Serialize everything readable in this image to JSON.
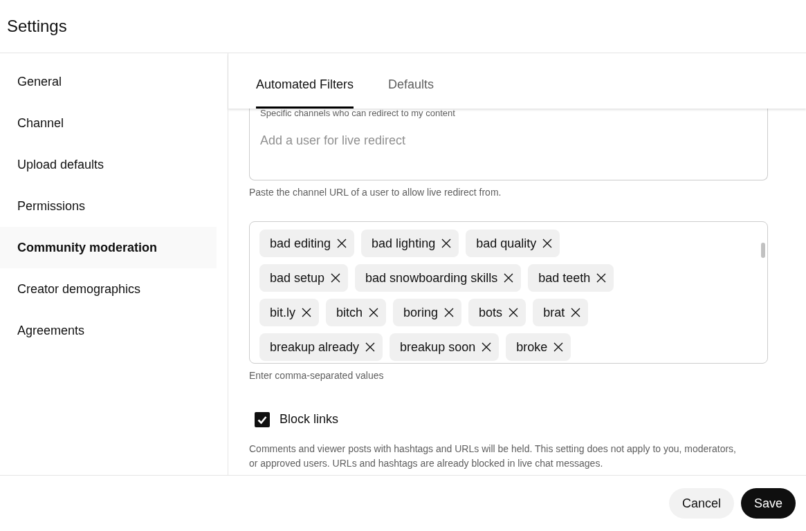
{
  "title": "Settings",
  "sidebar": {
    "items": [
      {
        "label": "General",
        "selected": false
      },
      {
        "label": "Channel",
        "selected": false
      },
      {
        "label": "Upload defaults",
        "selected": false
      },
      {
        "label": "Permissions",
        "selected": false
      },
      {
        "label": "Community moderation",
        "selected": true
      },
      {
        "label": "Creator demographics",
        "selected": false
      },
      {
        "label": "Agreements",
        "selected": false
      }
    ]
  },
  "tabs": [
    {
      "label": "Automated Filters",
      "selected": true
    },
    {
      "label": "Defaults",
      "selected": false
    }
  ],
  "redirect_field": {
    "label": "Specific channels who can redirect to my content",
    "placeholder": "Add a user for live redirect",
    "helper": "Paste the channel URL of a user to allow live redirect from."
  },
  "blocked_words": {
    "chips": [
      "bad editing",
      "bad lighting",
      "bad quality",
      "bad setup",
      "bad snowboarding skills",
      "bad teeth",
      "bit.ly",
      "bitch",
      "boring",
      "bots",
      "brat",
      "breakup already",
      "breakup soon",
      "broke"
    ],
    "helper": "Enter comma-separated values"
  },
  "block_links": {
    "label": "Block links",
    "checked": true,
    "description": "Comments and viewer posts with hashtags and URLs will be held. This setting does not apply to you, moderators, or approved users. URLs and hashtags are already blocked in live chat messages."
  },
  "buttons": [
    {
      "label": "Cancel",
      "kind": "secondary"
    },
    {
      "label": "Save",
      "kind": "primary"
    }
  ]
}
